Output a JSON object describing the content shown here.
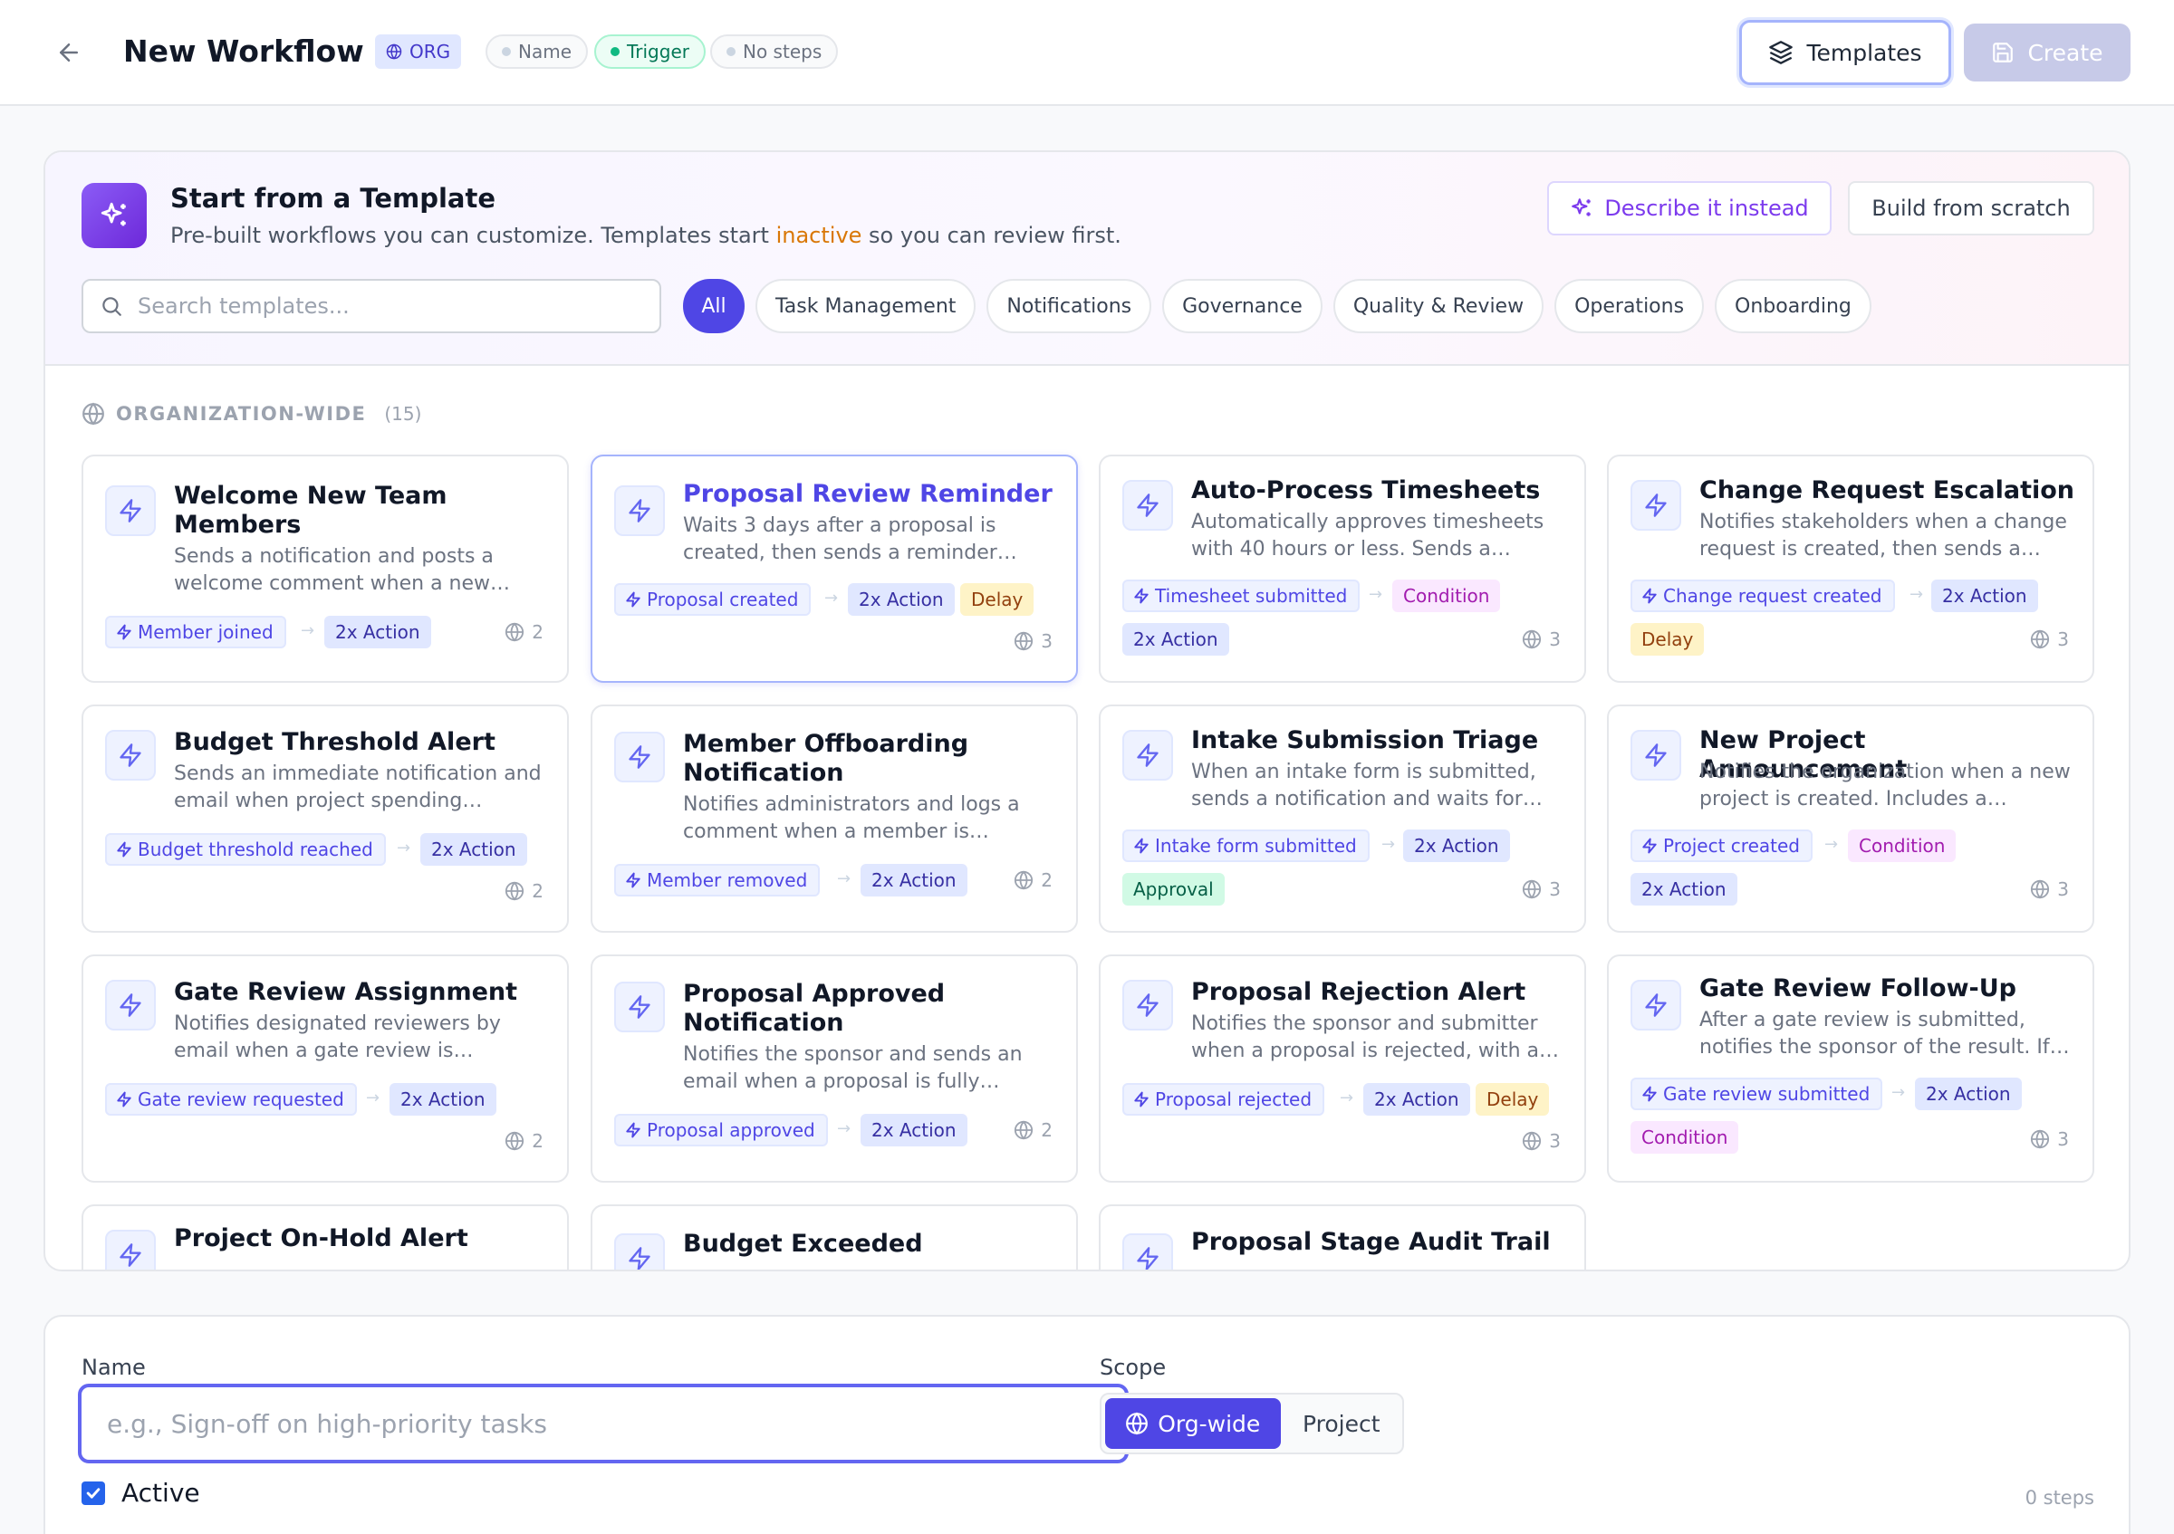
{
  "header": {
    "title": "New Workflow",
    "org_badge": "ORG",
    "status_name": "Name",
    "status_trigger": "Trigger",
    "status_steps": "No steps",
    "templates_button": "Templates",
    "create_button": "Create"
  },
  "templates": {
    "title": "Start from a Template",
    "subtitle_before": "Pre-built workflows you can customize. Templates start ",
    "subtitle_highlight": "inactive",
    "subtitle_after": " so you can review first.",
    "describe_button": "Describe it instead",
    "scratch_button": "Build from scratch",
    "search_placeholder": "Search templates...",
    "filters": [
      "All",
      "Task Management",
      "Notifications",
      "Governance",
      "Quality & Review",
      "Operations",
      "Onboarding"
    ],
    "active_filter": "All",
    "section_label": "ORGANIZATION-WIDE",
    "section_count": "(15)",
    "selected_card": "Proposal Review Reminder",
    "cards": [
      {
        "title": "Welcome New Team Members",
        "desc": "Sends a notification and posts a welcome comment when a new…",
        "trigger": "Member joined",
        "action": "2x Action",
        "scope_count": "2"
      },
      {
        "title": "Proposal Review Reminder",
        "desc": "Waits 3 days after a proposal is created, then sends a reminder…",
        "trigger": "Proposal created",
        "action": "2x Action",
        "extra": "Delay",
        "scope_count": "3"
      },
      {
        "title": "Auto-Process Timesheets",
        "desc": "Automatically approves timesheets with 40 hours or less. Sends a…",
        "trigger": "Timesheet submitted",
        "extra": "Condition",
        "action": "2x Action",
        "scope_count": "3"
      },
      {
        "title": "Change Request Escalation",
        "desc": "Notifies stakeholders when a change request is created, then sends a…",
        "trigger": "Change request created",
        "action": "2x Action",
        "extra": "Delay",
        "scope_count": "3"
      },
      {
        "title": "Budget Threshold Alert",
        "desc": "Sends an immediate notification and email when project spending…",
        "trigger": "Budget threshold reached",
        "action": "2x Action",
        "scope_count": "2"
      },
      {
        "title": "Member Offboarding Notification",
        "desc": "Notifies administrators and logs a comment when a member is…",
        "trigger": "Member removed",
        "action": "2x Action",
        "scope_count": "2"
      },
      {
        "title": "Intake Submission Triage",
        "desc": "When an intake form is submitted, sends a notification and waits for…",
        "trigger": "Intake form submitted",
        "action": "2x Action",
        "extra": "Approval",
        "scope_count": "3"
      },
      {
        "title": "New Project Announcement",
        "desc": "Notifies the organization when a new project is created. Includes a…",
        "trigger": "Project created",
        "extra": "Condition",
        "action": "2x Action",
        "scope_count": "3"
      },
      {
        "title": "Gate Review Assignment",
        "desc": "Notifies designated reviewers by email when a gate review is…",
        "trigger": "Gate review requested",
        "action": "2x Action",
        "scope_count": "2"
      },
      {
        "title": "Proposal Approved Notification",
        "desc": "Notifies the sponsor and sends an email when a proposal is fully…",
        "trigger": "Proposal approved",
        "action": "2x Action",
        "scope_count": "2"
      },
      {
        "title": "Proposal Rejection Alert",
        "desc": "Notifies the sponsor and submitter when a proposal is rejected, with a…",
        "trigger": "Proposal rejected",
        "action": "2x Action",
        "extra": "Delay",
        "scope_count": "3"
      },
      {
        "title": "Gate Review Follow-Up",
        "desc": "After a gate review is submitted, notifies the sponsor of the result. If…",
        "trigger": "Gate review submitted",
        "action": "2x Action",
        "extra": "Condition",
        "scope_count": "3"
      },
      {
        "title": "Project On-Hold Alert"
      },
      {
        "title": "Budget Exceeded"
      },
      {
        "title": "Proposal Stage Audit Trail"
      }
    ]
  },
  "form": {
    "name_label": "Name",
    "name_placeholder": "e.g., Sign-off on high-priority tasks",
    "name_value": "",
    "scope_label": "Scope",
    "scope_org": "Org-wide",
    "scope_project": "Project",
    "scope_selected": "Org-wide",
    "active_label": "Active",
    "active_checked": true,
    "steps_count": "0 steps"
  },
  "colors": {
    "accent": "#4f46e5",
    "trigger_green": "#10b981",
    "highlight_orange": "#d97706",
    "delay_bg": "#fef3c7",
    "condition_bg": "#fae8ff",
    "approval_bg": "#d1fae5"
  },
  "icons": {
    "back": "arrow-left-icon",
    "org": "globe-icon",
    "templates": "layers-icon",
    "create": "save-icon",
    "template_header": "sparkles-icon",
    "card": "lightning-icon",
    "search": "search-icon",
    "checkbox": "check-icon"
  }
}
